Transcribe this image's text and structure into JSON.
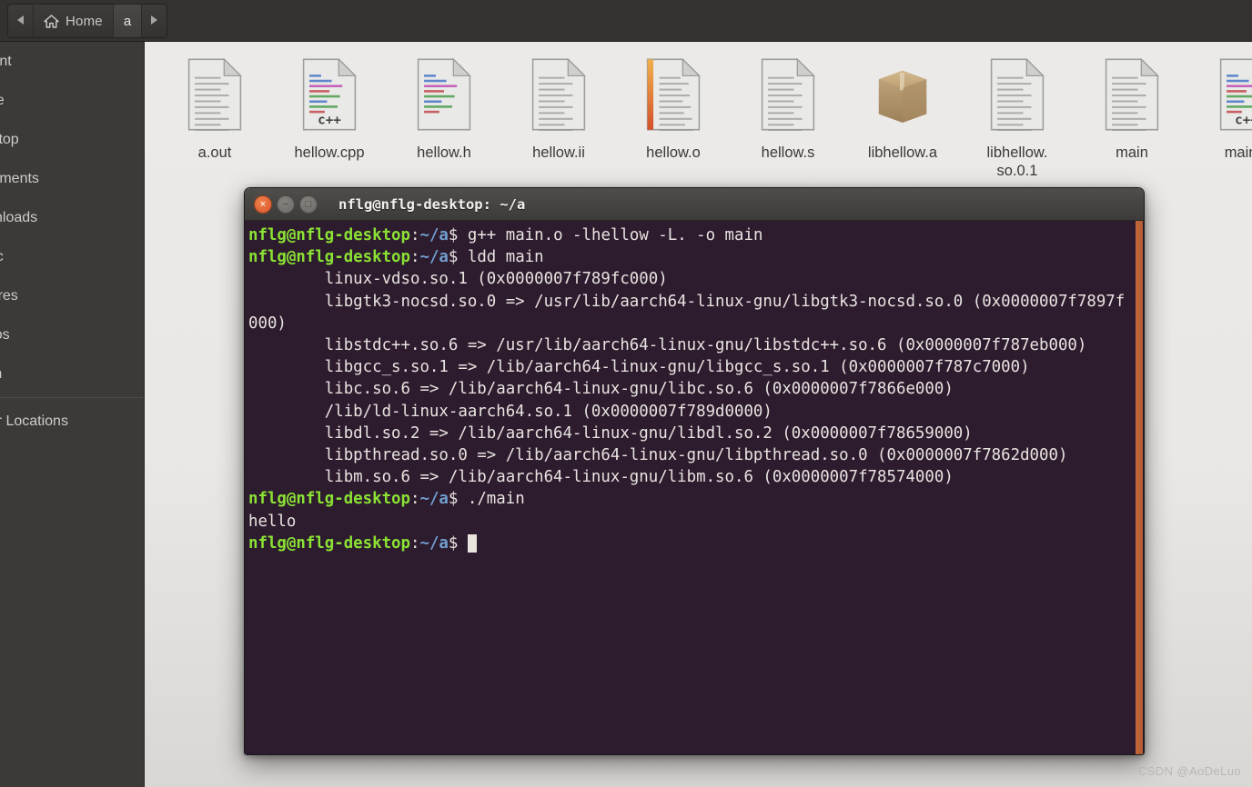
{
  "window": {
    "app": "Files",
    "background_color": "#e6e5e3"
  },
  "pathbar": {
    "back_label": "◀",
    "forward_label": "▶",
    "home_label": "Home",
    "current_label": "a"
  },
  "sidebar": {
    "items": [
      {
        "label": "Recent"
      },
      {
        "label": "Home"
      },
      {
        "label": "Desktop"
      },
      {
        "label": "Documents"
      },
      {
        "label": "Downloads"
      },
      {
        "label": "Music"
      },
      {
        "label": "Pictures"
      },
      {
        "label": "Videos"
      },
      {
        "label": "Trash"
      },
      {
        "label": "Other Locations"
      }
    ]
  },
  "files": [
    {
      "name": "a.out",
      "icon": "text-document-icon"
    },
    {
      "name": "hellow.cpp",
      "icon": "cpp-source-icon"
    },
    {
      "name": "hellow.h",
      "icon": "header-source-icon"
    },
    {
      "name": "hellow.ii",
      "icon": "text-document-icon"
    },
    {
      "name": "hellow.o",
      "icon": "object-file-icon"
    },
    {
      "name": "hellow.s",
      "icon": "text-document-icon"
    },
    {
      "name": "libhellow.a",
      "icon": "archive-package-icon"
    },
    {
      "name": "libhellow.\nso.0.1",
      "icon": "text-document-icon"
    },
    {
      "name": "main",
      "icon": "text-document-icon"
    },
    {
      "name": "main.c",
      "icon": "cpp-source-icon"
    }
  ],
  "terminal": {
    "title": "nflg@nflg-desktop: ~/a",
    "close_glyph": "×",
    "minimize_glyph": "−",
    "maximize_glyph": "□",
    "background_color": "#2d1b2e",
    "prompt_user": "nflg@nflg-desktop",
    "prompt_path": "~/a",
    "lines": [
      {
        "type": "prompt",
        "command": "g++ main.o -lhellow -L. -o main"
      },
      {
        "type": "prompt",
        "command": "ldd main"
      },
      {
        "type": "output",
        "text": "\tlinux-vdso.so.1 (0x0000007f789fc000)"
      },
      {
        "type": "output",
        "text": "\tlibgtk3-nocsd.so.0 => /usr/lib/aarch64-linux-gnu/libgtk3-nocsd.so.0 (0x0000007f7897f000)"
      },
      {
        "type": "output",
        "text": "\tlibstdc++.so.6 => /usr/lib/aarch64-linux-gnu/libstdc++.so.6 (0x0000007f787eb000)"
      },
      {
        "type": "output",
        "text": "\tlibgcc_s.so.1 => /lib/aarch64-linux-gnu/libgcc_s.so.1 (0x0000007f787c7000)"
      },
      {
        "type": "output",
        "text": "\tlibc.so.6 => /lib/aarch64-linux-gnu/libc.so.6 (0x0000007f7866e000)"
      },
      {
        "type": "output",
        "text": "\t/lib/ld-linux-aarch64.so.1 (0x0000007f789d0000)"
      },
      {
        "type": "output",
        "text": "\tlibdl.so.2 => /lib/aarch64-linux-gnu/libdl.so.2 (0x0000007f78659000)"
      },
      {
        "type": "output",
        "text": "\tlibpthread.so.0 => /lib/aarch64-linux-gnu/libpthread.so.0 (0x0000007f7862d000)"
      },
      {
        "type": "output",
        "text": "\tlibm.so.6 => /lib/aarch64-linux-gnu/libm.so.6 (0x0000007f78574000)"
      },
      {
        "type": "prompt",
        "command": "./main"
      },
      {
        "type": "output",
        "text": "hello"
      },
      {
        "type": "prompt",
        "command": "",
        "cursor": true
      }
    ]
  },
  "watermark": "CSDN @AoDeLuo"
}
